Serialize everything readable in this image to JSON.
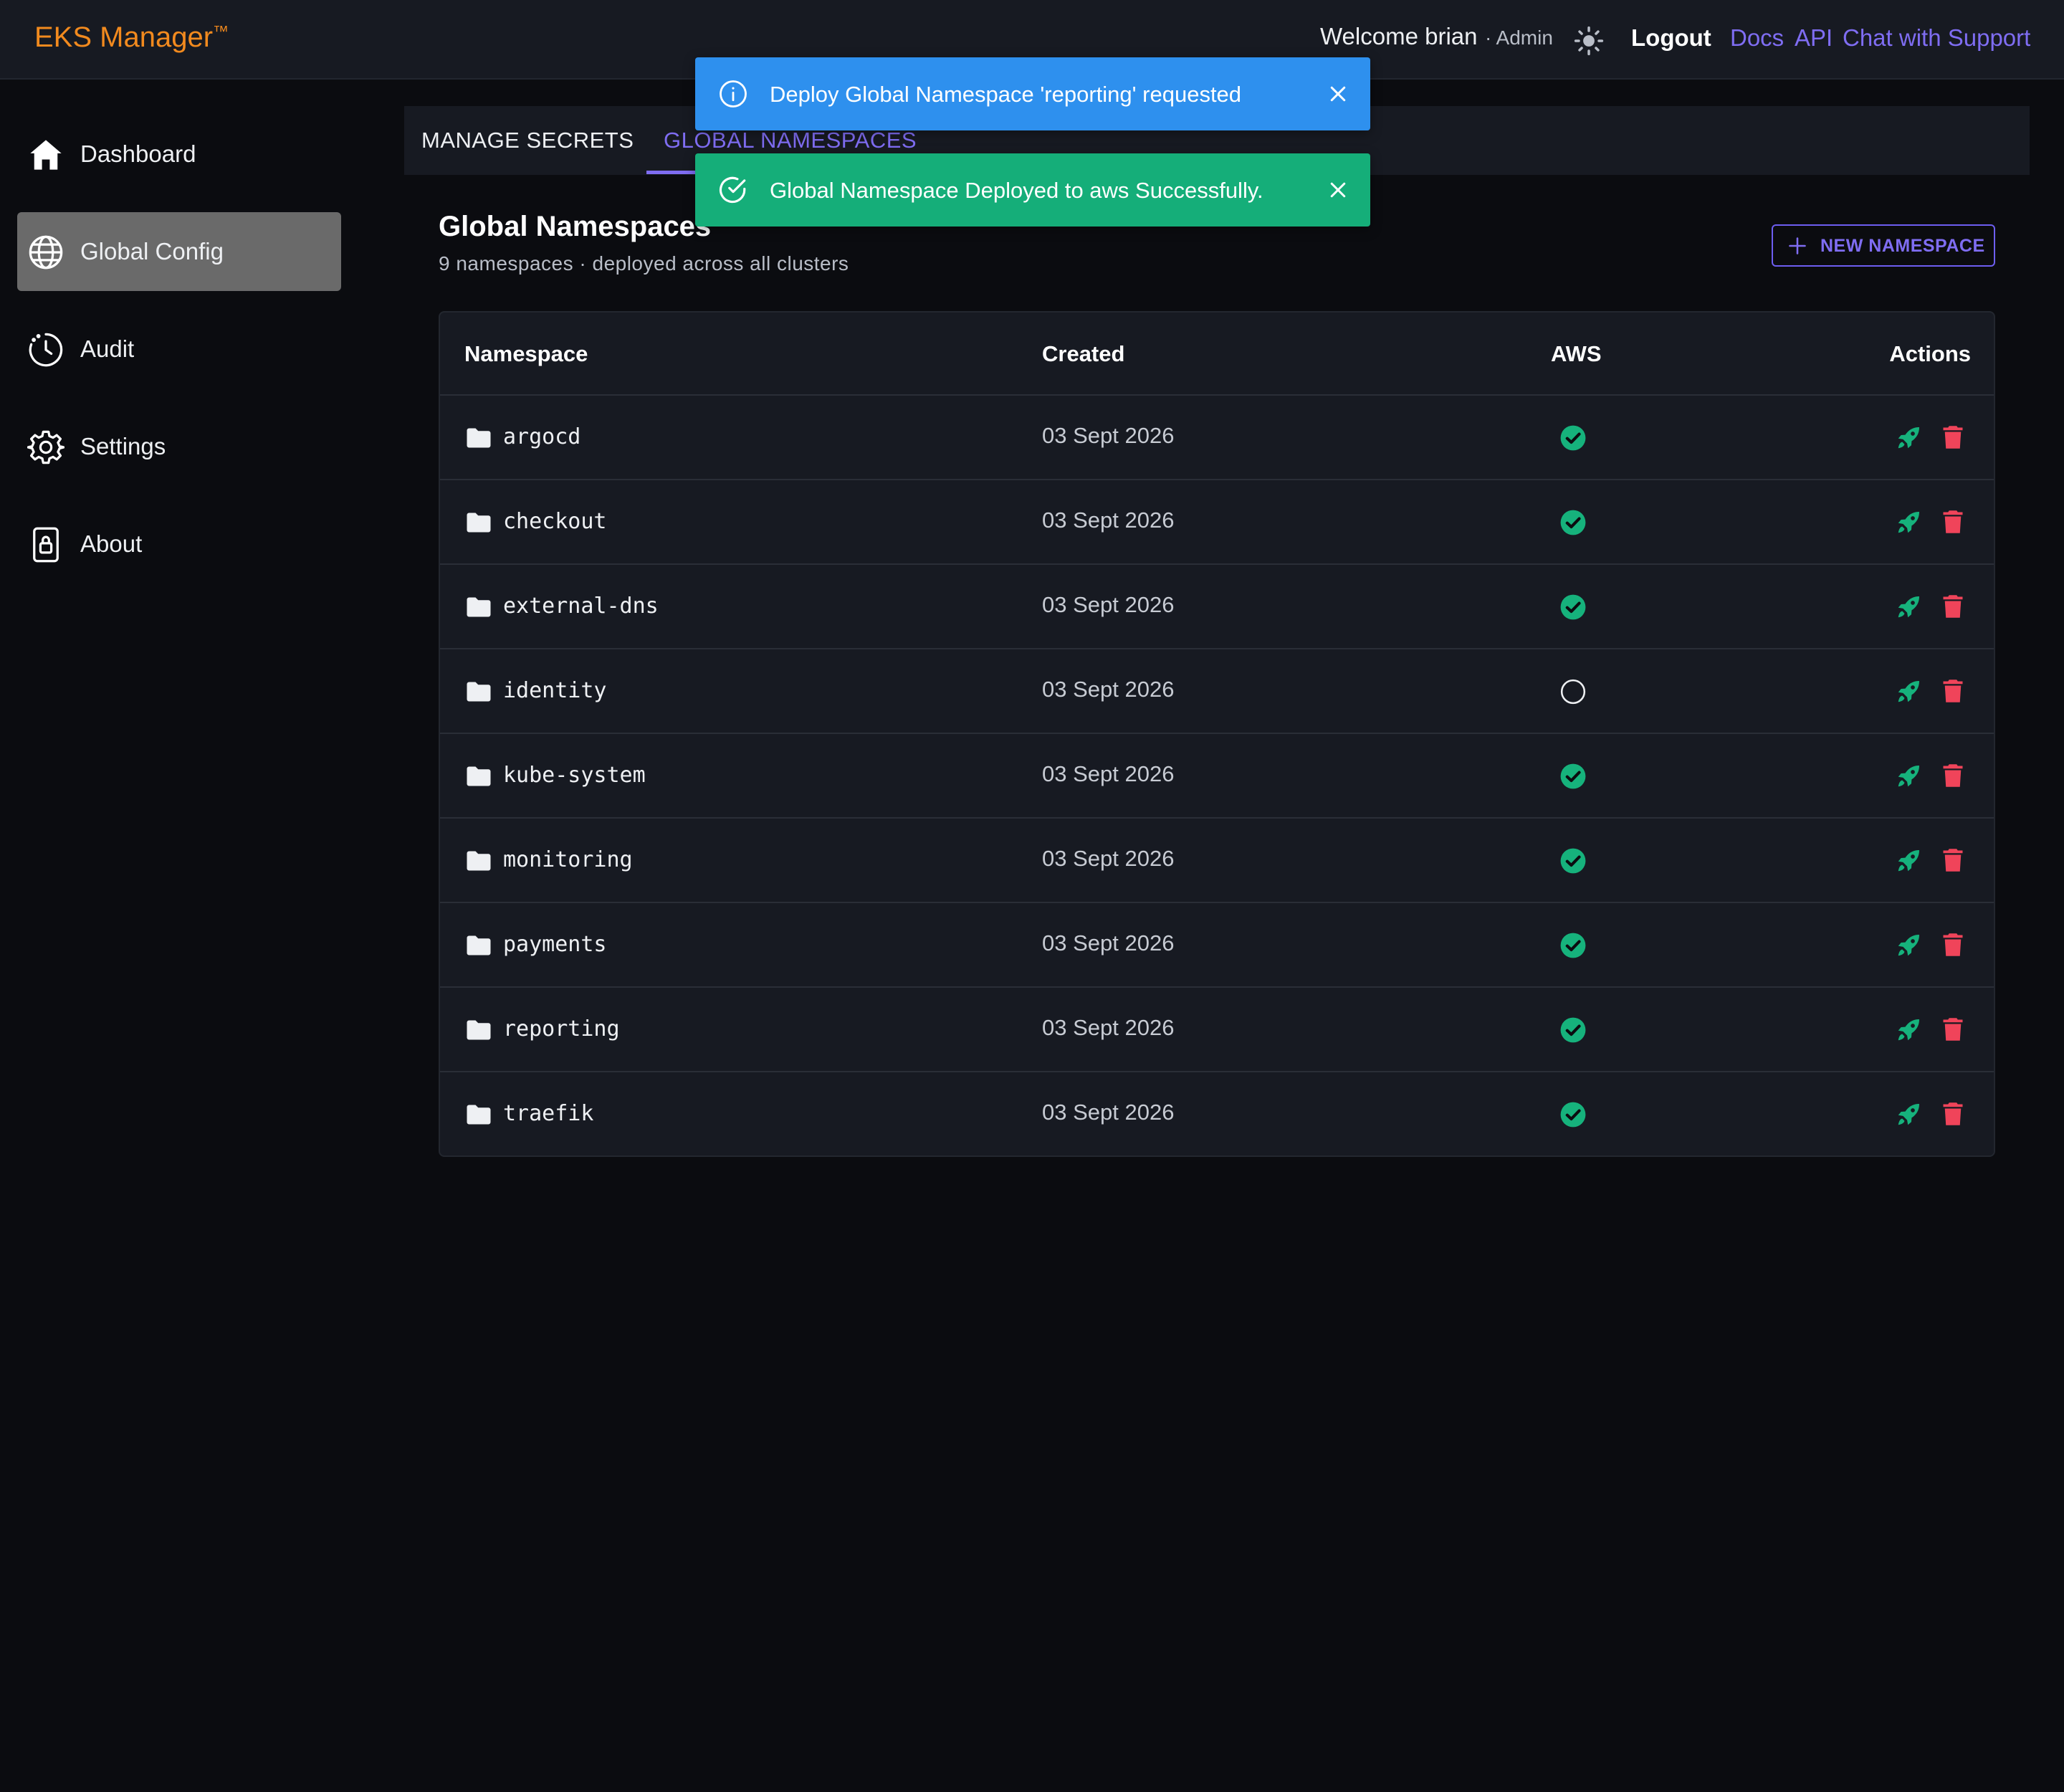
{
  "header": {
    "brand": "EKS Manager",
    "brand_tm": "™",
    "welcome": "Welcome brian",
    "role": "· Admin",
    "theme_icon": "sun-icon",
    "logout": "Logout",
    "links": [
      "Docs",
      "API",
      "Chat with Support"
    ]
  },
  "sidebar": {
    "items": [
      {
        "label": "Dashboard",
        "icon": "home-icon",
        "active": false
      },
      {
        "label": "Global Config",
        "icon": "globe-icon",
        "active": true
      },
      {
        "label": "Audit",
        "icon": "clock-icon",
        "active": false
      },
      {
        "label": "Settings",
        "icon": "gear-icon",
        "active": false
      },
      {
        "label": "About",
        "icon": "lock-icon",
        "active": false
      }
    ]
  },
  "tabs": [
    {
      "label": "MANAGE SECRETS",
      "active": false
    },
    {
      "label": "GLOBAL NAMESPACES",
      "active": true
    }
  ],
  "section": {
    "title": "Global Namespaces",
    "subtitle": "9 namespaces · deployed across all clusters",
    "new_button": "NEW NAMESPACE"
  },
  "table": {
    "columns": [
      "Namespace",
      "Created",
      "AWS",
      "Actions"
    ],
    "rows": [
      {
        "name": "argocd",
        "created": "03 Sept 2026",
        "aws_deployed": true
      },
      {
        "name": "checkout",
        "created": "03 Sept 2026",
        "aws_deployed": true
      },
      {
        "name": "external-dns",
        "created": "03 Sept 2026",
        "aws_deployed": true
      },
      {
        "name": "identity",
        "created": "03 Sept 2026",
        "aws_deployed": false
      },
      {
        "name": "kube-system",
        "created": "03 Sept 2026",
        "aws_deployed": true
      },
      {
        "name": "monitoring",
        "created": "03 Sept 2026",
        "aws_deployed": true
      },
      {
        "name": "payments",
        "created": "03 Sept 2026",
        "aws_deployed": true
      },
      {
        "name": "reporting",
        "created": "03 Sept 2026",
        "aws_deployed": true
      },
      {
        "name": "traefik",
        "created": "03 Sept 2026",
        "aws_deployed": true
      }
    ]
  },
  "toasts": [
    {
      "type": "info",
      "message": "Deploy Global Namespace 'reporting' requested"
    },
    {
      "type": "success",
      "message": "Global Namespace Deployed to aws Successfully."
    }
  ],
  "colors": {
    "accent": "#7f6df2",
    "brand": "#f28a1e",
    "success": "#16b27c",
    "danger": "#f0445a",
    "info_toast": "#2e90ee",
    "success_toast": "#15ae79"
  }
}
